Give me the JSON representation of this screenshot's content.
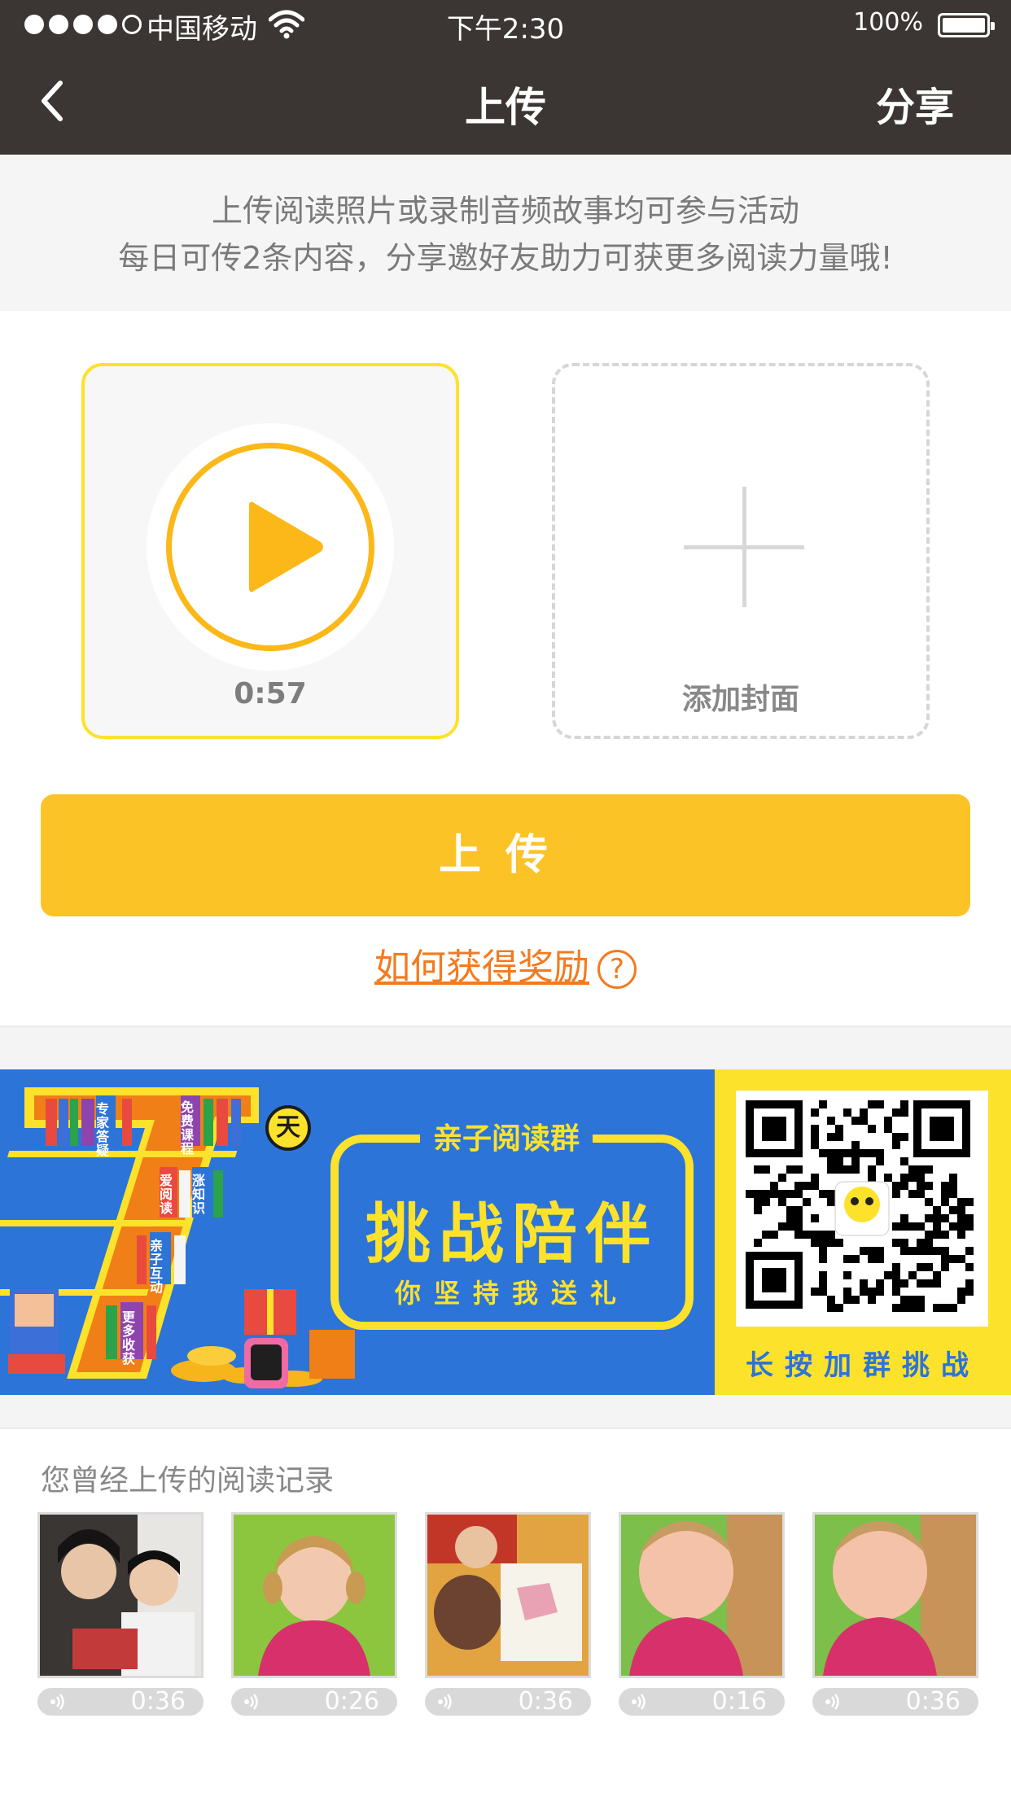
{
  "status_bar": {
    "carrier": "中国移动",
    "time": "下午2:30",
    "battery": "100%",
    "battery_level": 1.0,
    "signal_bars_filled": 4,
    "signal_bars_total": 5
  },
  "nav": {
    "title": "上传",
    "share_label": "分享",
    "back_icon": "chevron-left-icon"
  },
  "notice": {
    "line1": "上传阅读照片或录制音频故事均可参与活动",
    "line2": "每日可传2条内容，分享邀好友助力可获更多阅读力量哦!"
  },
  "audio_card": {
    "duration": "0:57",
    "icon": "play-icon"
  },
  "cover_card": {
    "label": "添加封面",
    "icon": "plus-icon"
  },
  "upload_button": {
    "label": "上传"
  },
  "reward_link": {
    "label": "如何获得奖励",
    "help_icon_text": "?"
  },
  "banner": {
    "number": "7",
    "badge": "天",
    "kicker": "亲子阅读群",
    "title": "挑战陪伴",
    "subtitle": "你坚持我送礼",
    "qr_caption": "长按加群挑战",
    "shelf_labels": [
      "专家答疑",
      "免费课程",
      "爱阅读",
      "涨知识",
      "亲子互动",
      "更多收获"
    ]
  },
  "history": {
    "title": "您曾经上传的阅读记录",
    "items": [
      {
        "duration": "0:36"
      },
      {
        "duration": "0:26"
      },
      {
        "duration": "0:36"
      },
      {
        "duration": "0:16"
      },
      {
        "duration": "0:36"
      }
    ]
  },
  "colors": {
    "nav_bg": "#3b3634",
    "accent_yellow": "#fcc327",
    "play_orange": "#fbb818",
    "link_orange": "#f47a1e",
    "banner_blue": "#2c74d8",
    "banner_yellow": "#fde22b"
  }
}
